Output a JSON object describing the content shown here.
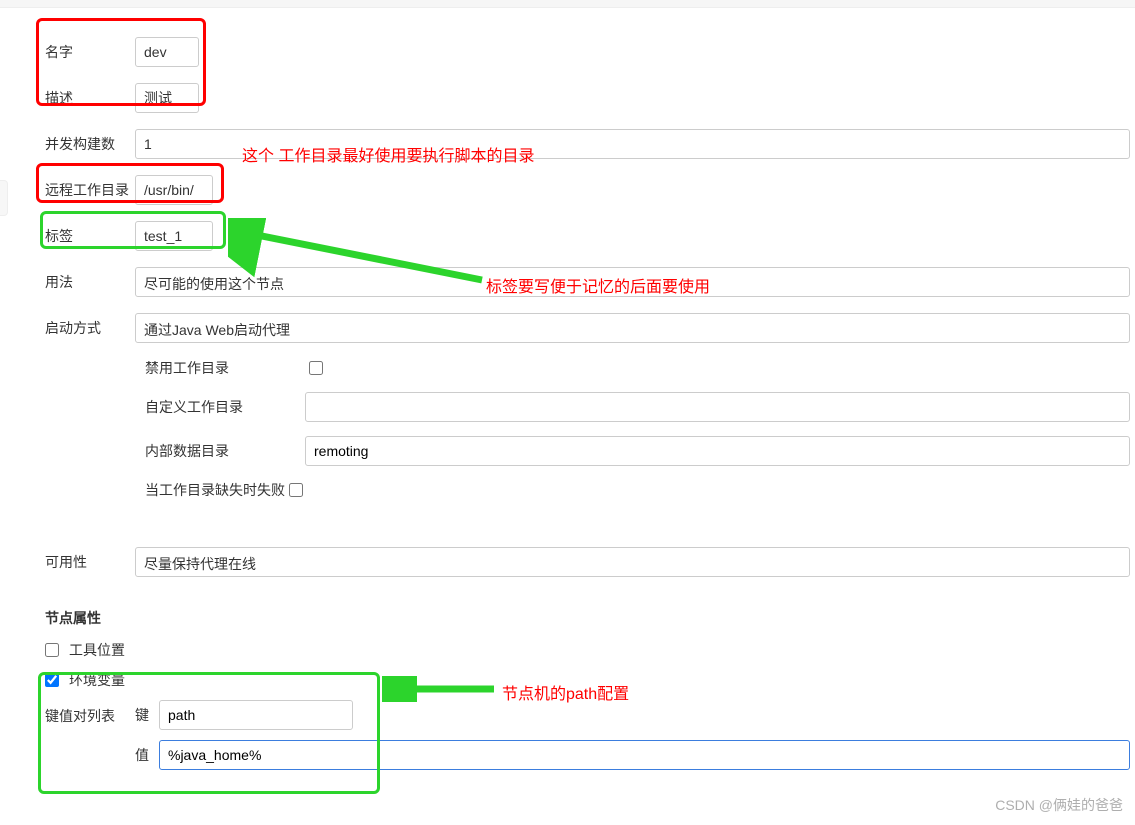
{
  "form": {
    "name": {
      "label": "名字",
      "value": "dev"
    },
    "description": {
      "label": "描述",
      "value": "测试"
    },
    "executors": {
      "label": "并发构建数",
      "value": "1"
    },
    "remote_dir": {
      "label": "远程工作目录",
      "value": "/usr/bin/"
    },
    "labels": {
      "label": "标签",
      "value": "test_1"
    },
    "usage": {
      "label": "用法",
      "value": "尽可能的使用这个节点"
    },
    "launch_method": {
      "label": "启动方式",
      "value": "通过Java Web启动代理"
    },
    "disable_workdir": {
      "label": "禁用工作目录",
      "checked": false
    },
    "custom_workdir": {
      "label": "自定义工作目录",
      "value": ""
    },
    "internal_data_dir": {
      "label": "内部数据目录",
      "value": "remoting"
    },
    "fail_when_missing": {
      "label": "当工作目录缺失时失败",
      "checked": false
    },
    "availability": {
      "label": "可用性",
      "value": "尽量保持代理在线"
    }
  },
  "node_props": {
    "title": "节点属性",
    "tool_location": {
      "label": "工具位置",
      "checked": false
    },
    "env_vars": {
      "label": "环境变量",
      "checked": true
    },
    "kv_list_label": "键值对列表",
    "key_label": "键",
    "key_value": "path",
    "value_label": "值",
    "value_value": "%java_home%"
  },
  "annotations": {
    "note_workdir": "这个 工作目录最好使用要执行脚本的目录",
    "note_label": "标签要写便于记忆的后面要使用",
    "note_path": "节点机的path配置"
  },
  "watermark": "CSDN @俩娃的爸爸"
}
